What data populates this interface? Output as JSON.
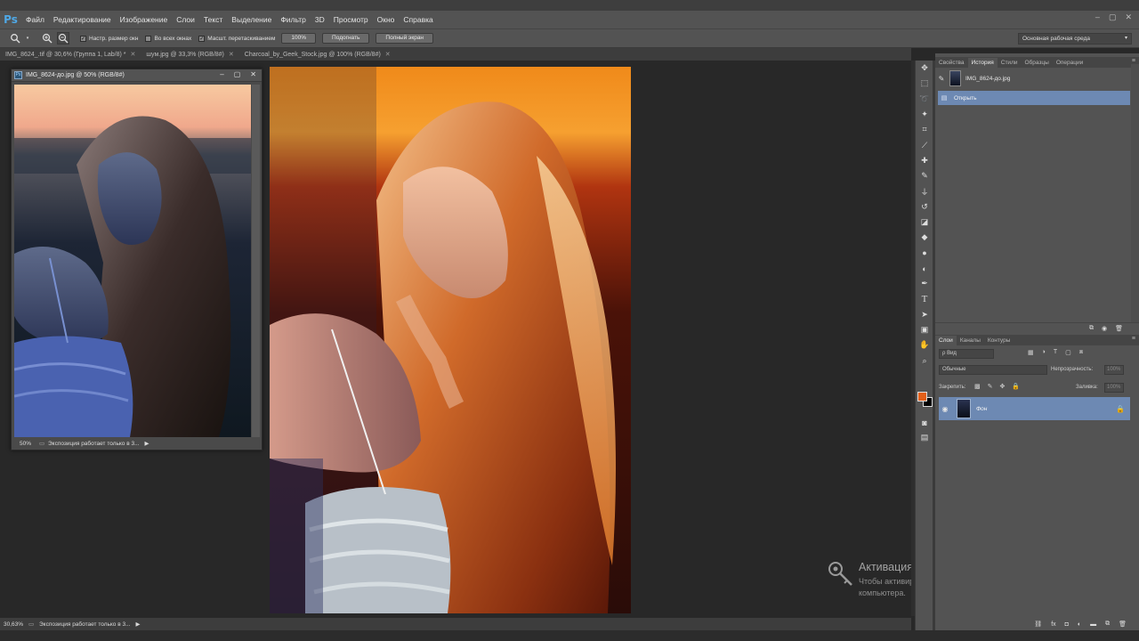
{
  "app": {
    "logo": "Ps"
  },
  "menu": [
    "Файл",
    "Редактирование",
    "Изображение",
    "Слои",
    "Текст",
    "Выделение",
    "Фильтр",
    "3D",
    "Просмотр",
    "Окно",
    "Справка"
  ],
  "window_controls": [
    "–",
    "▢",
    "✕"
  ],
  "options_bar": {
    "tool_icon": "zoom-icon",
    "check1": "Настр. размер окн",
    "check2": "Во всех окнах",
    "check3": "Масшт. перетаскиванием",
    "btn_100": "100%",
    "btn_fit": "Подогнать",
    "btn_full": "Полный экран",
    "workspace": "Основная рабочая среда"
  },
  "tabs": [
    "IMG_8624_.tif @ 30,6% (Группа 1, Lab/8) *",
    "шум.jpg @ 33,3% (RGB/8#)",
    "Charcoal_by_Geek_Stock.jpg @ 100% (RGB/8#)"
  ],
  "float_window": {
    "title": "IMG_8624-до.jpg @ 50% (RGB/8#)",
    "zoom": "50%",
    "status": "Экспозиция работает только в 3..."
  },
  "bottom_status": {
    "zoom": "30,63%",
    "text": "Экспозиция работает только в 3..."
  },
  "activation": {
    "title": "Активация Windows",
    "text": "Чтобы активировать Windows, перейдите к параметрам компьютера."
  },
  "history_panel": {
    "tabs": [
      "Свойства",
      "История",
      "Стили",
      "Образцы",
      "Операции"
    ],
    "snapshot": "IMG_8624-до.jpg",
    "open_item": "Открыть"
  },
  "layers_panel": {
    "tabs": [
      "Слои",
      "Каналы",
      "Контуры"
    ],
    "filter": "ρ Вид",
    "blend_mode": "Обычные",
    "opacity_label": "Непрозрачность:",
    "opacity_value": "100%",
    "lock_label": "Закрепить:",
    "fill_label": "Заливка:",
    "fill_value": "100%",
    "layer_name": "Фон"
  },
  "colors": {
    "foreground": "#e2601a",
    "background": "#000000",
    "accent": "#6d89b3"
  }
}
